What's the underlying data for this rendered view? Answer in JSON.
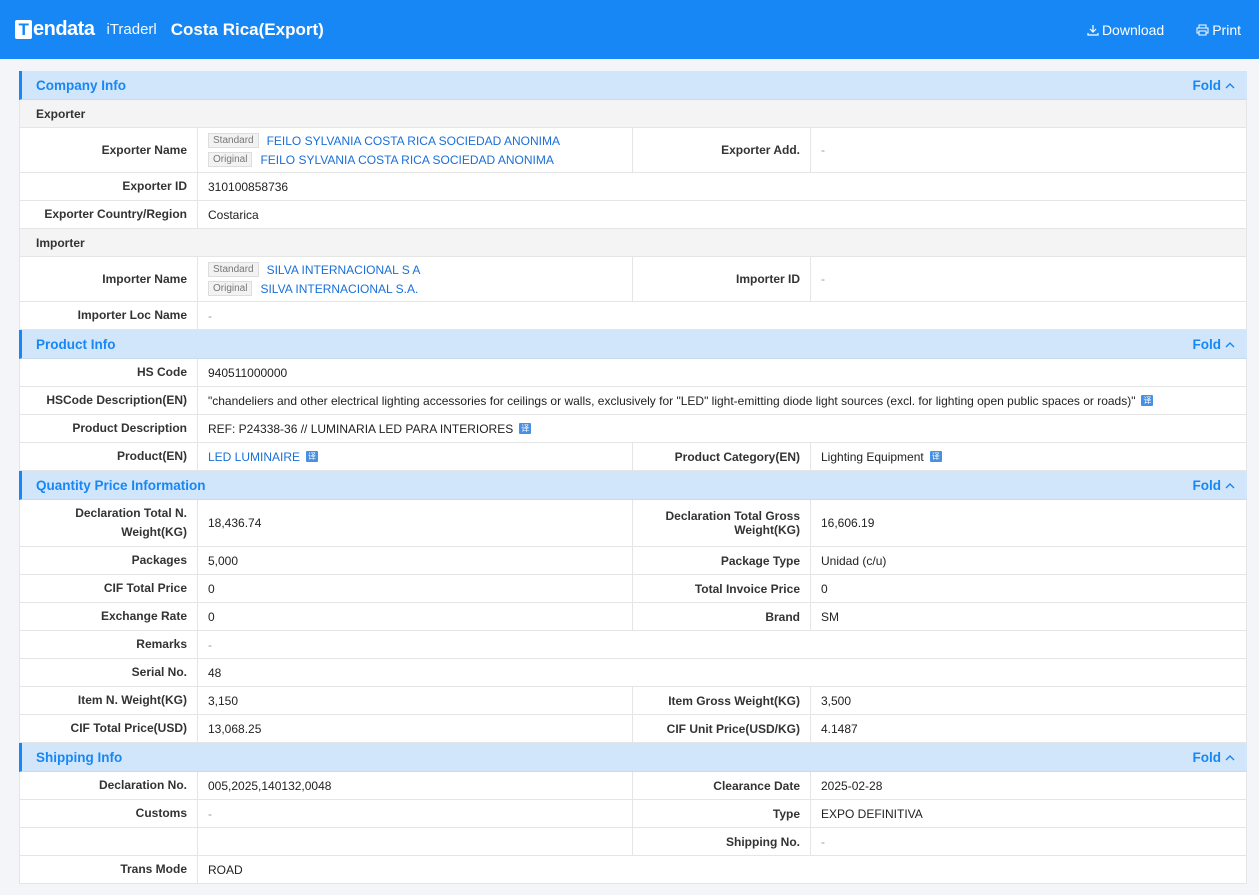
{
  "header": {
    "brand": "endata",
    "brand_t": "T",
    "itrader": "iTraderl",
    "title": "Costa Rica(Export)",
    "download": "Download",
    "print": "Print"
  },
  "fold_label": "Fold",
  "company": {
    "title": "Company Info",
    "exporter_head": "Exporter",
    "exporter_name_label": "Exporter Name",
    "standard_tag": "Standard",
    "original_tag": "Original",
    "exporter_name_standard": "FEILO SYLVANIA COSTA RICA SOCIEDAD ANONIMA",
    "exporter_name_original": "FEILO SYLVANIA COSTA RICA SOCIEDAD ANONIMA",
    "exporter_add_label": "Exporter Add.",
    "exporter_add": "-",
    "exporter_id_label": "Exporter ID",
    "exporter_id": "310100858736",
    "exporter_country_label": "Exporter Country/Region",
    "exporter_country": "Costarica",
    "importer_head": "Importer",
    "importer_name_label": "Importer Name",
    "importer_name_standard": "SILVA INTERNACIONAL S A",
    "importer_name_original": "SILVA INTERNACIONAL S.A.",
    "importer_id_label": "Importer ID",
    "importer_id": "-",
    "importer_loc_label": "Importer  Loc Name",
    "importer_loc": "-"
  },
  "product": {
    "title": "Product Info",
    "hs_code_label": "HS Code",
    "hs_code": "940511000000",
    "hs_desc_label": "HSCode Description(EN)",
    "hs_desc": "\"chandeliers and other electrical lighting accessories for ceilings or walls, exclusively for \"LED\" light-emitting diode light sources (excl. for lighting open public spaces or roads)\"",
    "prod_desc_label": "Product Description",
    "prod_desc": "REF: P24338-36 // LUMINARIA LED PARA INTERIORES",
    "product_en_label": "Product(EN)",
    "product_en": "LED LUMINAIRE",
    "category_label": "Product Category(EN)",
    "category": "Lighting Equipment",
    "translate_glyph": "译"
  },
  "quantity": {
    "title": "Quantity Price Information",
    "net_weight_label": "Declaration Total N. Weight(KG)",
    "net_weight": "18,436.74",
    "gross_weight_label": "Declaration Total Gross Weight(KG)",
    "gross_weight": "16,606.19",
    "packages_label": "Packages",
    "packages": "5,000",
    "package_type_label": "Package Type",
    "package_type": "Unidad (c/u)",
    "cif_total_label": "CIF Total Price",
    "cif_total": "0",
    "invoice_label": "Total Invoice Price",
    "invoice": "0",
    "exchange_label": "Exchange Rate",
    "exchange": "0",
    "brand_label": "Brand",
    "brand": "SM",
    "remarks_label": "Remarks",
    "remarks": "-",
    "serial_label": "Serial No.",
    "serial": "48",
    "item_net_label": "Item N. Weight(KG)",
    "item_net": "3,150",
    "item_gross_label": "Item Gross Weight(KG)",
    "item_gross": "3,500",
    "cif_usd_label": "CIF Total Price(USD)",
    "cif_usd": "13,068.25",
    "cif_unit_label": "CIF Unit Price(USD/KG)",
    "cif_unit": "4.1487"
  },
  "shipping": {
    "title": "Shipping Info",
    "decl_no_label": "Declaration No.",
    "decl_no": "005,2025,140132,0048",
    "clearance_label": "Clearance Date",
    "clearance": "2025-02-28",
    "customs_label": "Customs",
    "customs": "-",
    "type_label": "Type",
    "type": "EXPO DEFINITIVA",
    "shipping_no_label": "Shipping No.",
    "shipping_no": "-",
    "trans_mode_label": "Trans Mode",
    "trans_mode": "ROAD"
  }
}
